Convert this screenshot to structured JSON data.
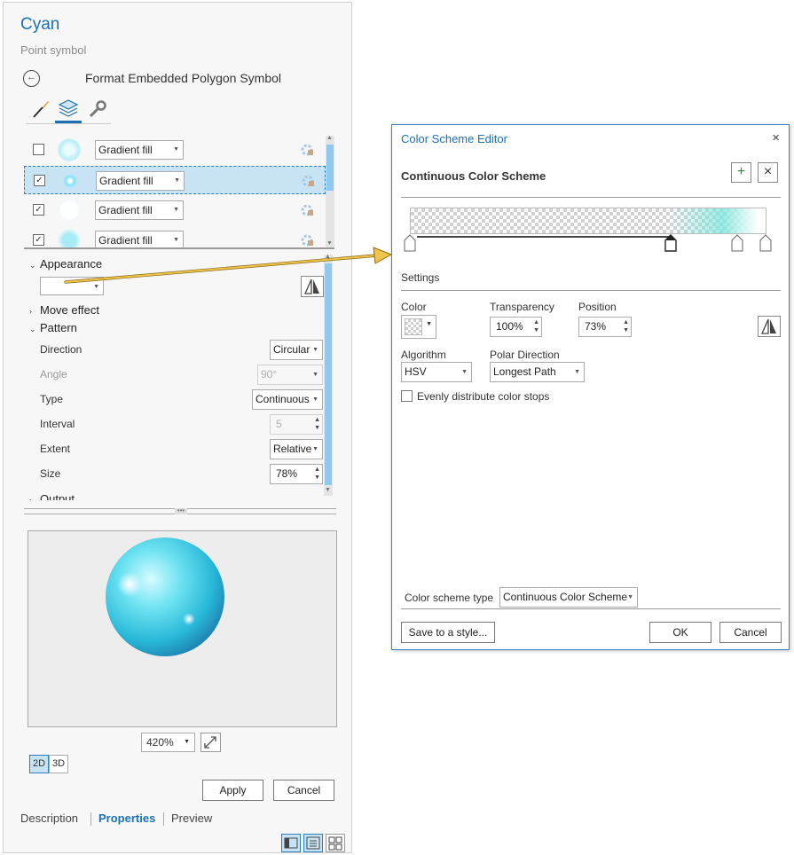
{
  "pane": {
    "title": "Cyan",
    "subtitle": "Point symbol",
    "format_title": "Format Embedded Polygon Symbol",
    "layers": [
      {
        "checked": false,
        "type": "Gradient fill"
      },
      {
        "checked": true,
        "type": "Gradient fill"
      },
      {
        "checked": true,
        "type": "Gradient fill"
      },
      {
        "checked": true,
        "type": "Gradient fill"
      }
    ],
    "appearance_label": "Appearance",
    "move_effect_label": "Move effect",
    "pattern_label": "Pattern",
    "output_label": "Output",
    "props": {
      "direction": {
        "label": "Direction",
        "value": "Circular"
      },
      "angle": {
        "label": "Angle",
        "value": "90°"
      },
      "type": {
        "label": "Type",
        "value": "Continuous"
      },
      "interval": {
        "label": "Interval",
        "value": "5"
      },
      "extent": {
        "label": "Extent",
        "value": "Relative"
      },
      "size": {
        "label": "Size",
        "value": "78%"
      }
    },
    "zoom": "420%",
    "dim_2d": "2D",
    "dim_3d": "3D",
    "apply": "Apply",
    "cancel": "Cancel",
    "tabs": [
      "Description",
      "Properties",
      "Preview"
    ]
  },
  "dialog": {
    "title": "Color Scheme Editor",
    "close_icon": "×",
    "scheme_heading": "Continuous Color Scheme",
    "add_icon": "+",
    "delete_icon": "×",
    "settings_label": "Settings",
    "color_label": "Color",
    "transparency_label": "Transparency",
    "transparency_value": "100%",
    "position_label": "Position",
    "position_value": "73%",
    "algorithm_label": "Algorithm",
    "algorithm_value": "HSV",
    "polar_label": "Polar Direction",
    "polar_value": "Longest Path",
    "evenly_label": "Evenly distribute color stops",
    "evenly_checked": false,
    "scheme_type_label": "Color scheme type",
    "scheme_type_value": "Continuous Color Scheme",
    "save_btn": "Save to a style...",
    "ok_btn": "OK",
    "cancel_btn": "Cancel",
    "color_stops_percent": [
      0,
      73,
      92,
      100
    ],
    "selected_stop_percent": 73
  },
  "colors": {
    "accent": "#1b6fb3",
    "selection": "#c8e3f3",
    "arrow": "#e2b53a",
    "preview_sphere": "#3cc8e0"
  }
}
